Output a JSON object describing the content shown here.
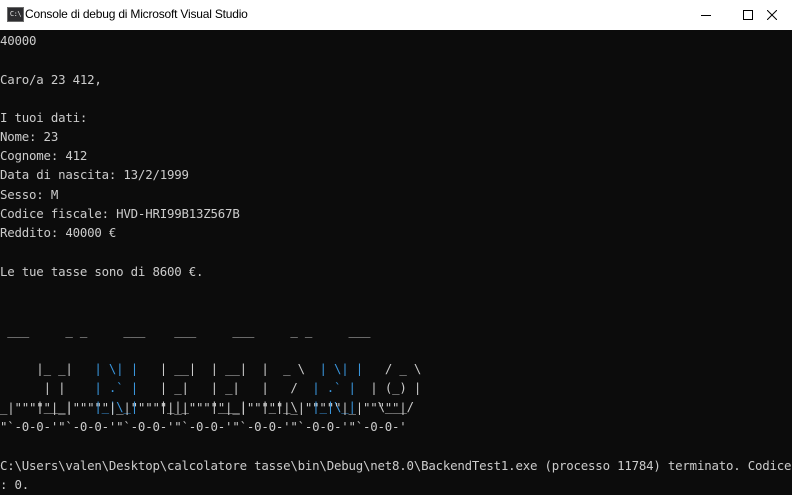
{
  "window": {
    "title": "Console di debug di Microsoft Visual Studio",
    "icon_name": "console-app-icon",
    "icon_glyph": "C:\\",
    "controls": [
      "minimize-icon",
      "maximize-icon",
      "close-icon"
    ]
  },
  "console": {
    "background": "#0c0c0c",
    "text_color": "#cccccc",
    "lines": {
      "l1": "40000",
      "l2": "Caro/a 23 412,",
      "l3": "I tuoi dati:",
      "l4": "Nome: 23",
      "l5": "Cognome: 412",
      "l6": "Data di nascita: 13/2/1999",
      "l7": "Sesso: M",
      "l8": "Codice fiscale: HVD-HRI99B13Z567B",
      "l9": "Reddito: 40000 €",
      "l10": "Le tue tasse sono di 8600 €.",
      "l11": "C:\\Users\\valen\\Desktop\\calcolatore tasse\\bin\\Debug\\net8.0\\BackendTest1.exe (processo 11784) terminato. Codice restituito",
      "l12": ": 0."
    },
    "ascii_art": {
      "colors": {
        "default": "#cccccc",
        "letter_i": "#3a96dd",
        "letter_n": "#2aa5b5"
      },
      "row0": " ___     _ _     ___    ___     ___     _ _     ___  ",
      "row1a": " |_ _| ",
      "row1b": "  | \\| |  ",
      "row1c": " | __|  | __|  |  _ \\ ",
      "row1d": " | \\| | ",
      "row1e": "  / _ \\ ",
      "row2a": "  | |  ",
      "row2b": "  | .` |  ",
      "row2c": " | _|   | _|   |   / ",
      "row2d": " | .` | ",
      "row2e": " | (_) |",
      "row3a": " |___| ",
      "row3b": "  |_|\\_|  ",
      "row3c": " |_|_   |___|  |_|_\\ ",
      "row3d": " |_|\\_| ",
      "row3e": "  \\___/ ",
      "row4": "_|\"\"\"\"\"|_|\"\"\"\"\"|_|\"\"\"\"\"|_|\"\"\"\"\"|_|\"\"\"\"\"|_|\"\"\"\"\"|_|\"\"\"\"\"|",
      "row5": "\"`-0-0-'\"`-0-0-'\"`-0-0-'\"`-0-0-'\"`-0-0-'\"`-0-0-'\"`-0-0-'"
    }
  }
}
